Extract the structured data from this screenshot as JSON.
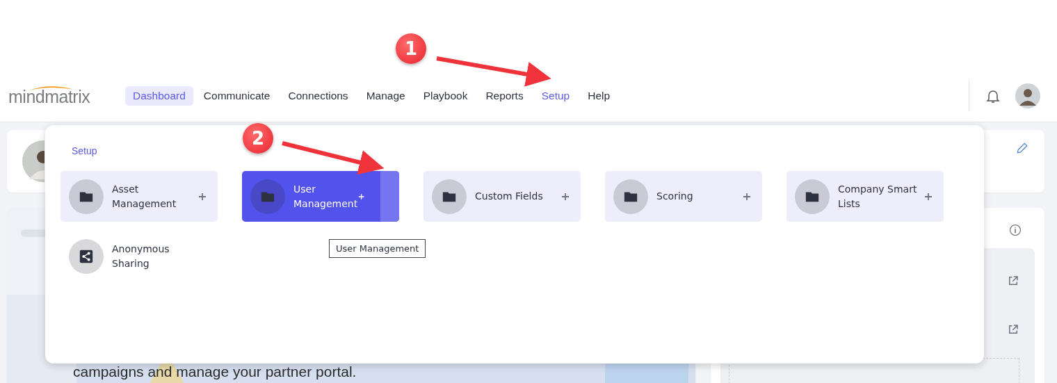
{
  "annotations": [
    {
      "label": "1"
    },
    {
      "label": "2"
    }
  ],
  "header": {
    "logo": "mindmatrix",
    "nav": [
      {
        "label": "Dashboard",
        "selected": true,
        "open": false
      },
      {
        "label": "Communicate",
        "selected": false,
        "open": false
      },
      {
        "label": "Connections",
        "selected": false,
        "open": false
      },
      {
        "label": "Manage",
        "selected": false,
        "open": false
      },
      {
        "label": "Playbook",
        "selected": false,
        "open": false
      },
      {
        "label": "Reports",
        "selected": false,
        "open": false
      },
      {
        "label": "Setup",
        "selected": false,
        "open": true
      },
      {
        "label": "Help",
        "selected": false,
        "open": false
      }
    ]
  },
  "dropdown": {
    "title": "Setup",
    "tiles": [
      {
        "label": "Asset Management",
        "kind": "folder",
        "selected": false,
        "addable": true
      },
      {
        "label": "User Management",
        "kind": "folder",
        "selected": true,
        "addable": true
      },
      {
        "label": "Custom Fields",
        "kind": "folder",
        "selected": false,
        "addable": true
      },
      {
        "label": "Scoring",
        "kind": "folder",
        "selected": false,
        "addable": true
      },
      {
        "label": "Company Smart Lists",
        "kind": "folder",
        "selected": false,
        "addable": true
      },
      {
        "label": "Anonymous Sharing",
        "kind": "share",
        "selected": false,
        "addable": false
      }
    ],
    "tooltip": "User Management"
  },
  "hero": {
    "text": "campaigns and manage your partner portal."
  }
}
